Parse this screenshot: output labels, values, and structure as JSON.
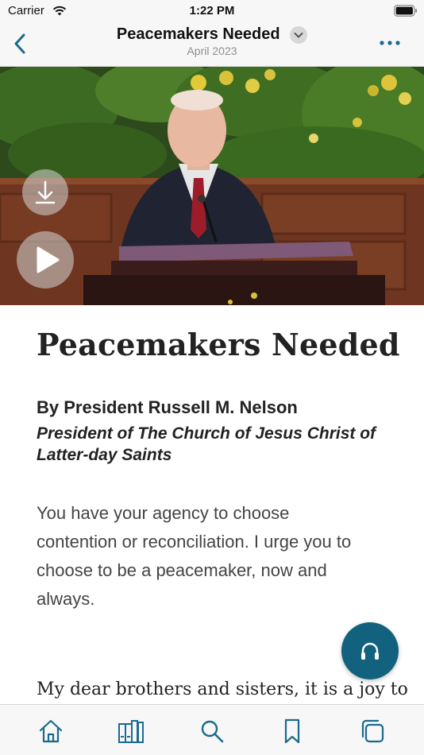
{
  "status_bar": {
    "carrier": "Carrier",
    "time": "1:22 PM",
    "icons": [
      "wifi-icon",
      "battery-icon"
    ]
  },
  "nav_bar": {
    "title": "Peacemakers Needed",
    "subtitle": "April 2023",
    "icons": [
      "back-chevron-icon",
      "chevron-down-icon",
      "more-ellipsis-icon"
    ]
  },
  "hero": {
    "icons": [
      "download-icon",
      "play-icon"
    ]
  },
  "article": {
    "title": "Peacemakers Needed",
    "author": "By President Russell M. Nelson",
    "author_role_line1": "President of The Church of Jesus Christ of",
    "author_role_line2": "Latter-day Saints",
    "kicker_lines": [
      "You have your agency to choose",
      "contention or reconciliation. I urge you to",
      "choose to be a peacemaker, now and",
      "always."
    ],
    "body_start": "My dear brothers and sisters, it is a joy to"
  },
  "audio_button": {
    "icon": "headphones-icon"
  },
  "tab_bar": {
    "tabs": [
      "home-icon",
      "library-icon",
      "search-icon",
      "bookmark-icon",
      "screens-icon"
    ]
  },
  "colors": {
    "accent": "#1b6a8c",
    "fab": "#11617f",
    "bar_background": "#f7f7f7"
  }
}
